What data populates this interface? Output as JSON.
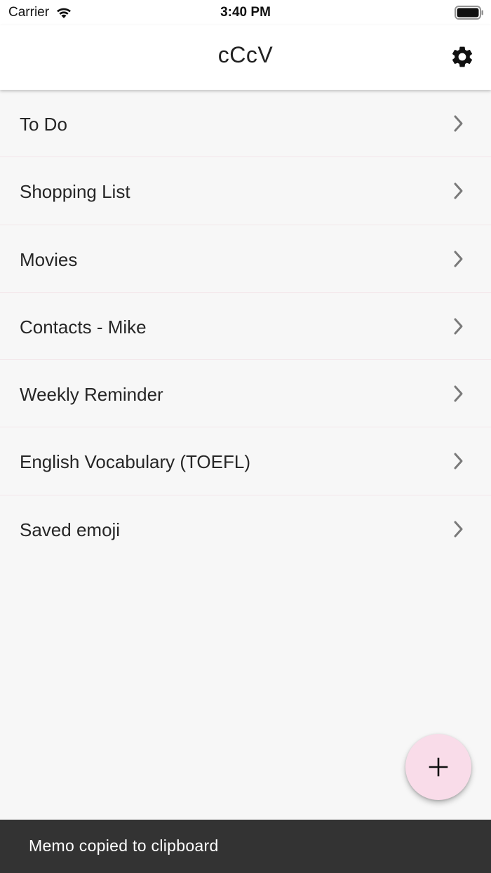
{
  "status_bar": {
    "carrier": "Carrier",
    "time": "3:40 PM",
    "wifi_icon": "wifi-icon",
    "battery_icon": "battery-icon"
  },
  "nav": {
    "title": "cCcV",
    "settings_icon": "gear-icon"
  },
  "lists": [
    {
      "label": "To Do"
    },
    {
      "label": "Shopping List"
    },
    {
      "label": "Movies"
    },
    {
      "label": "Contacts - Mike"
    },
    {
      "label": "Weekly Reminder"
    },
    {
      "label": "English Vocabulary (TOEFL)"
    },
    {
      "label": "Saved emoji"
    }
  ],
  "fab": {
    "icon": "plus-icon",
    "color": "#f9dce9"
  },
  "snackbar": {
    "message": "Memo copied to clipboard"
  },
  "colors": {
    "background": "#f7f7f7",
    "divider": "#f3e6ea",
    "snackbar": "#333333"
  }
}
